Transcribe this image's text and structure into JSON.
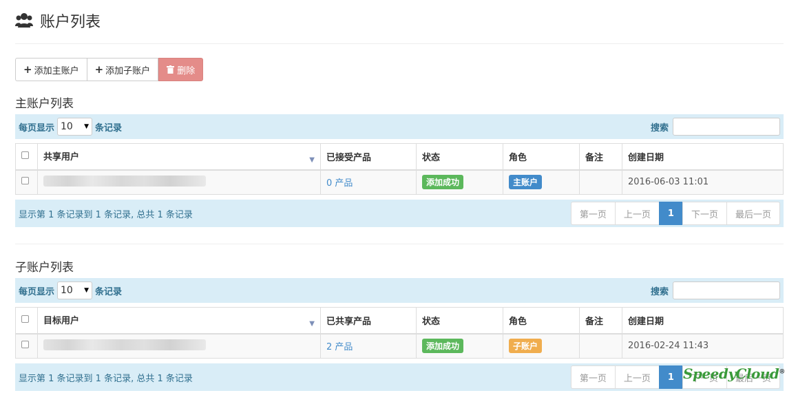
{
  "header": {
    "title": "账户列表",
    "icon": "users-icon"
  },
  "actions": {
    "add_main": "添加主账户",
    "add_sub": "添加子账户",
    "delete": "删除"
  },
  "main": {
    "section_title": "主账户列表",
    "per_page_prefix": "每页显示",
    "per_page_value": "10",
    "per_page_suffix": "条记录",
    "search_label": "搜索",
    "columns": [
      "共享用户",
      "已接受产品",
      "状态",
      "角色",
      "备注",
      "创建日期"
    ],
    "rows": [
      {
        "user": "",
        "products": "0 产品",
        "status": "添加成功",
        "role": "主账户",
        "remark": "",
        "created": "2016-06-03 11:01"
      }
    ],
    "info": "显示第 1 条记录到 1 条记录, 总共 1 条记录",
    "pagination": {
      "first": "第一页",
      "prev": "上一页",
      "current": "1",
      "next": "下一页",
      "last": "最后一页"
    }
  },
  "sub": {
    "section_title": "子账户列表",
    "per_page_prefix": "每页显示",
    "per_page_value": "10",
    "per_page_suffix": "条记录",
    "search_label": "搜索",
    "columns": [
      "目标用户",
      "已共享产品",
      "状态",
      "角色",
      "备注",
      "创建日期"
    ],
    "rows": [
      {
        "user": "",
        "products": "2 产品",
        "status": "添加成功",
        "role": "子账户",
        "remark": "",
        "created": "2016-02-24 11:43"
      }
    ],
    "info": "显示第 1 条记录到 1 条记录, 总共 1 条记录",
    "pagination": {
      "first": "第一页",
      "prev": "上一页",
      "current": "1",
      "next": "下一页",
      "last": "最后一页"
    }
  },
  "watermark": {
    "text": "SpeedyCloud",
    "mark": "®"
  },
  "colors": {
    "info_bg": "#d9edf7",
    "info_text": "#31708f",
    "primary": "#428bca",
    "success": "#5cb85c",
    "warning": "#f0ad4e",
    "danger": "#e48c89"
  }
}
